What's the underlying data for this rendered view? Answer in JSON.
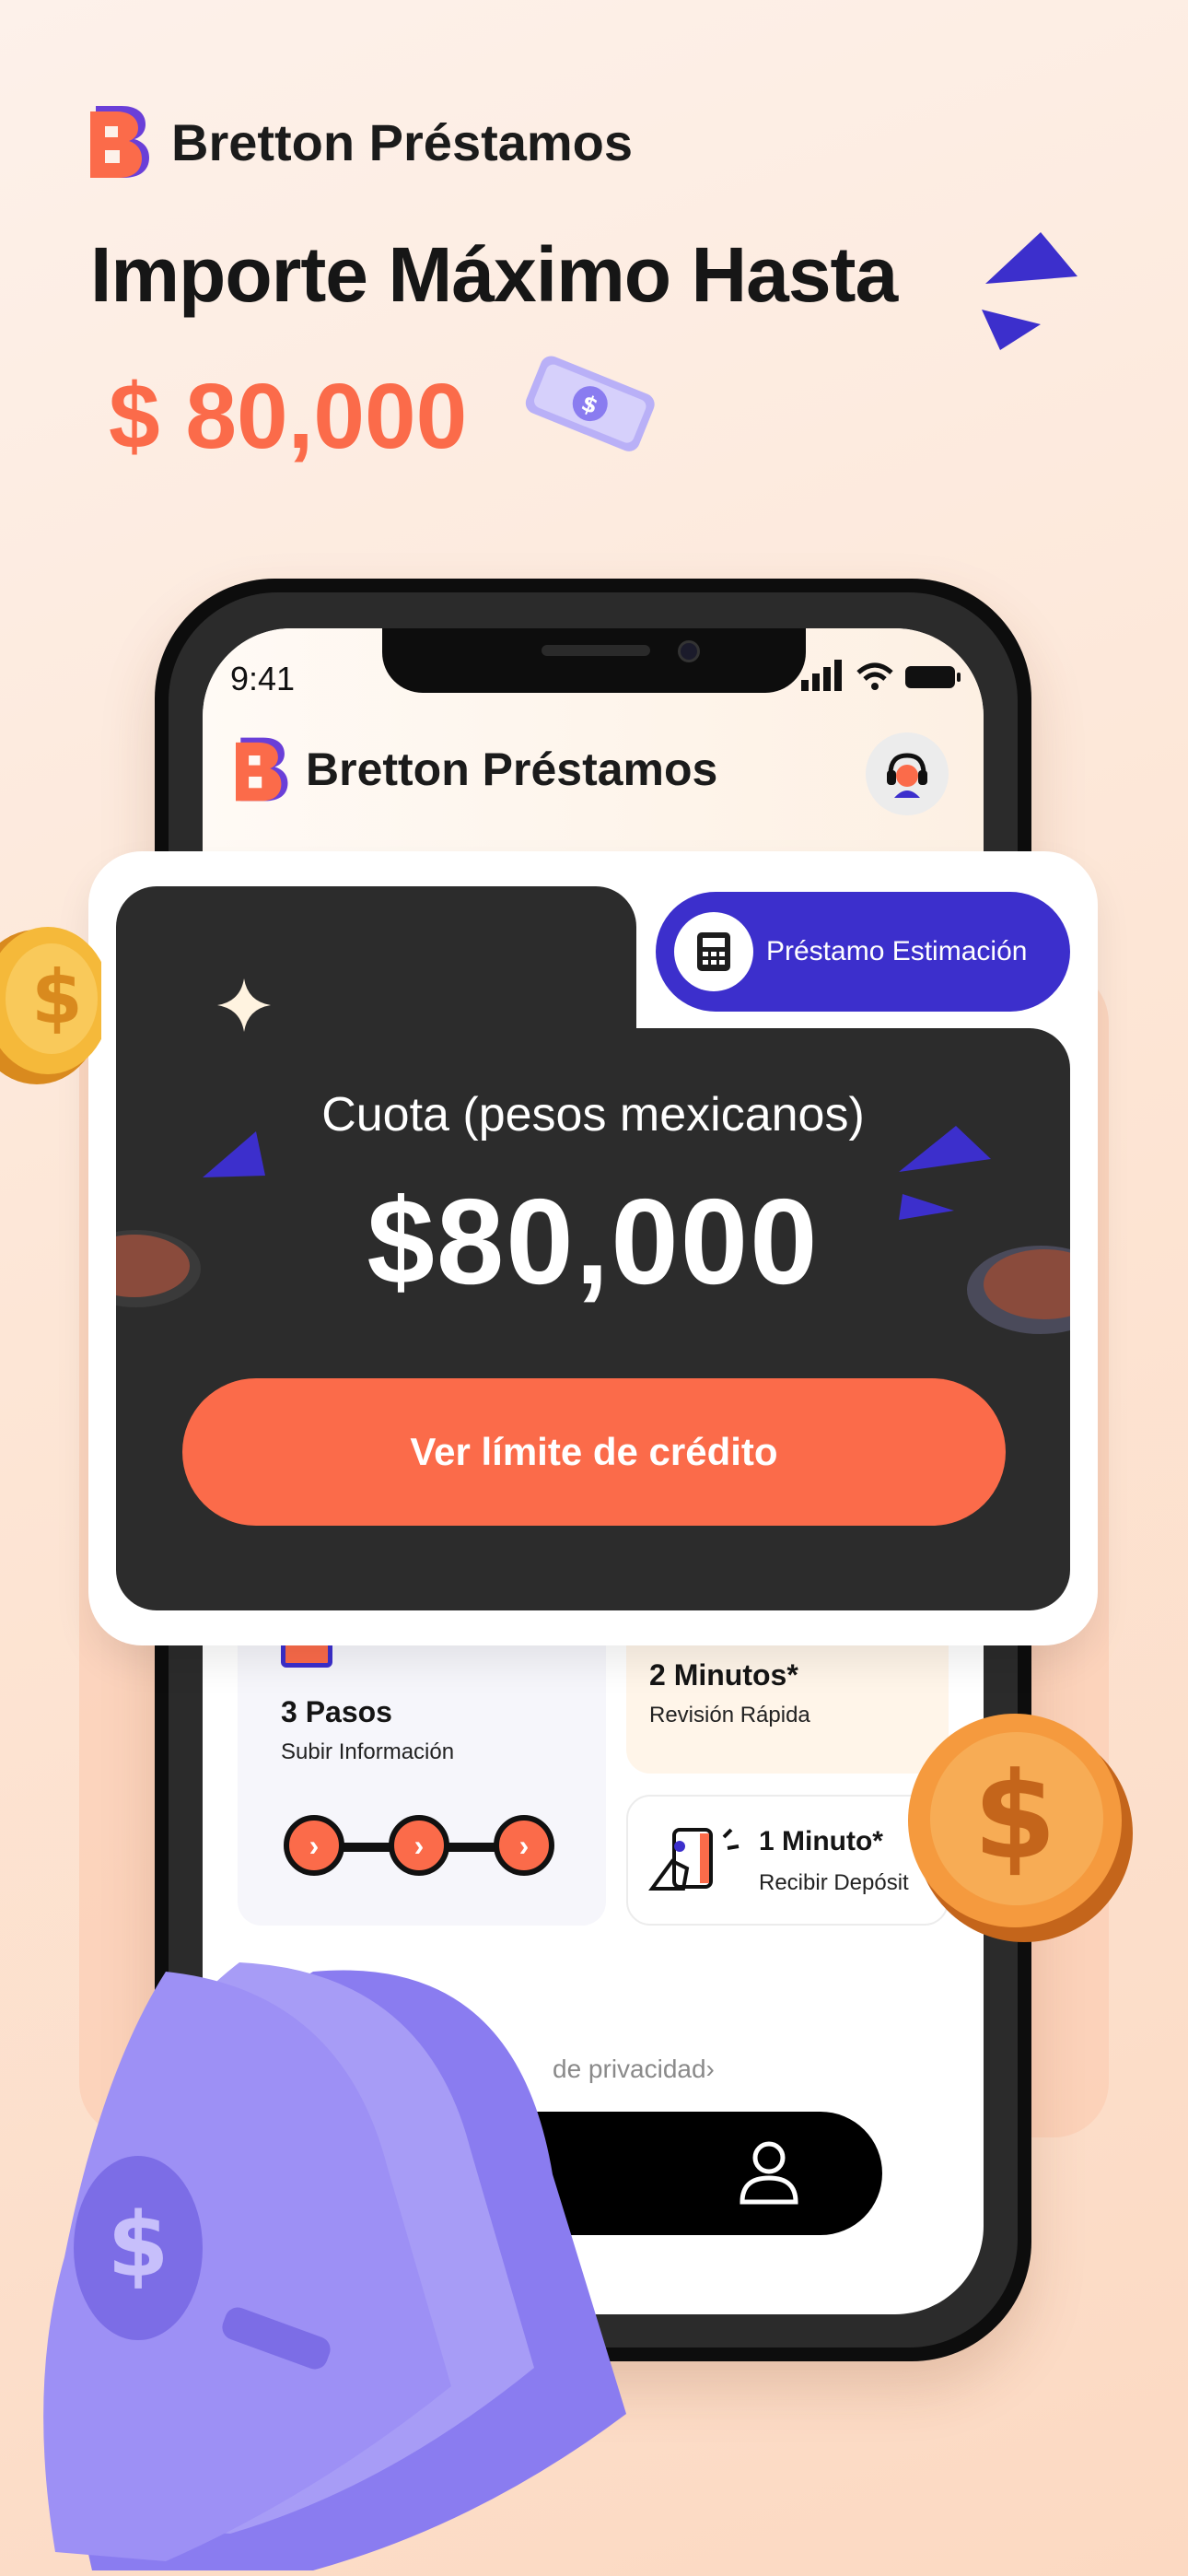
{
  "brand": {
    "name": "Bretton Préstamos"
  },
  "headline": "Importe Máximo Hasta",
  "max_amount": "$ 80,000",
  "status_bar": {
    "time": "9:41"
  },
  "promo": {
    "estimate_button": "Préstamo Estimación",
    "quota_label": "Cuota (pesos mexicanos)",
    "quota_amount": "$80,000",
    "cta_label": "Ver límite de crédito"
  },
  "steps": {
    "title": "3 Pasos",
    "subtitle": "Subir Información"
  },
  "review": {
    "title": "2 Minutos*",
    "subtitle": "Revisión Rápida"
  },
  "deposit": {
    "title": "1 Minuto*",
    "subtitle": "Recibir Depósit"
  },
  "privacy_link": "de privacidad›",
  "colors": {
    "accent": "#fb6b4a",
    "brand_purple": "#3c2fcc",
    "dark_card": "#2c2c2c"
  },
  "icons": [
    "logo-icon",
    "money-bill-icon",
    "support-icon",
    "calculator-icon",
    "step-arrow-icon",
    "card-hand-icon",
    "profile-icon",
    "coin-icon",
    "bill-stack-icon"
  ]
}
